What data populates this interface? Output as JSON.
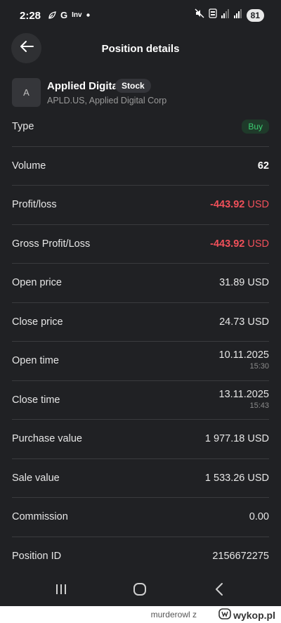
{
  "status_bar": {
    "time": "2:28",
    "icons_left": [
      "leaf-icon",
      "google-icon",
      "inv-icon",
      "dot-icon"
    ],
    "inv_text": "Inv",
    "icons_right": [
      "mute-icon",
      "volte-icon",
      "signal-icon",
      "signal-icon"
    ],
    "battery": "81"
  },
  "header": {
    "title": "Position details"
  },
  "instrument": {
    "avatar_letter": "A",
    "name": "Applied Digital",
    "tag": "Stock",
    "subtitle": "APLD.US, Applied Digital Corp"
  },
  "rows": {
    "type": {
      "label": "Type",
      "value": "Buy"
    },
    "volume": {
      "label": "Volume",
      "value": "62"
    },
    "profit_loss": {
      "label": "Profit/loss",
      "value": "-443.92",
      "unit": "USD"
    },
    "gross_profit_loss": {
      "label": "Gross Profit/Loss",
      "value": "-443.92",
      "unit": "USD"
    },
    "open_price": {
      "label": "Open price",
      "value": "31.89 USD"
    },
    "close_price": {
      "label": "Close price",
      "value": "24.73 USD"
    },
    "open_time": {
      "label": "Open time",
      "date": "10.11.2025",
      "time": "15:30"
    },
    "close_time": {
      "label": "Close time",
      "date": "13.11.2025",
      "time": "15:43"
    },
    "purchase_value": {
      "label": "Purchase value",
      "value": "1 977.18 USD"
    },
    "sale_value": {
      "label": "Sale value",
      "value": "1 533.26 USD"
    },
    "commission": {
      "label": "Commission",
      "value": "0.00"
    },
    "position_id": {
      "label": "Position ID",
      "value": "2156672275"
    }
  },
  "colors": {
    "background": "#202124",
    "negative": "#f0505a",
    "buy_green": "#3ccf72"
  },
  "footer": {
    "user": "murderowl",
    "separator": "z",
    "site": "wykop.pl"
  }
}
